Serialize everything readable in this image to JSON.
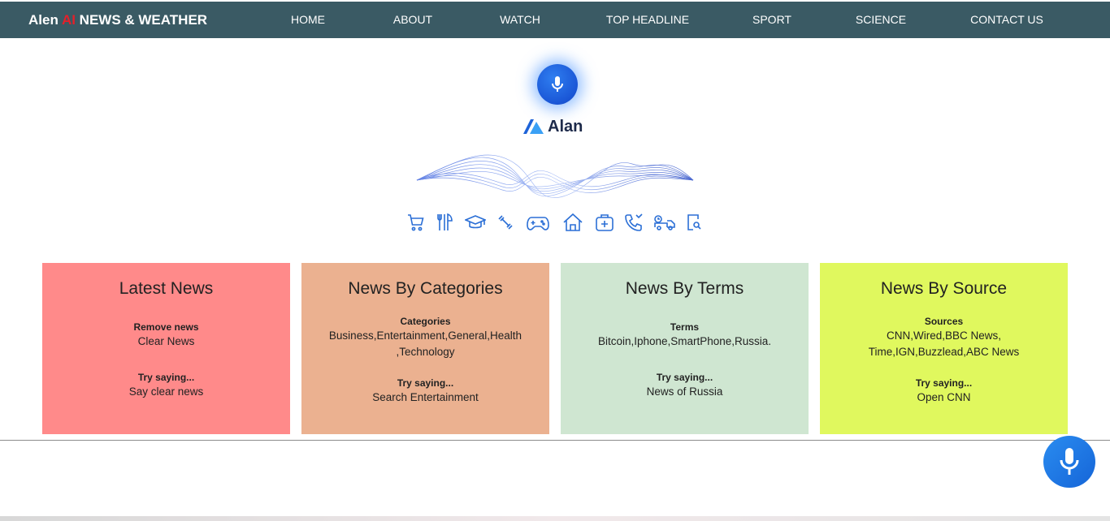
{
  "brand": {
    "prefix": "Alen ",
    "ai": "AI",
    "suffix": " NEWS & WEATHER"
  },
  "nav": [
    {
      "label": "HOME"
    },
    {
      "label": "ABOUT"
    },
    {
      "label": "WATCH"
    },
    {
      "label": "TOP HEADLINE"
    },
    {
      "label": "SPORT"
    },
    {
      "label": "SCIENCE"
    },
    {
      "label": "CONTACT US"
    }
  ],
  "assistant": {
    "name": "Alan"
  },
  "icons": [
    "cart-icon",
    "utensils-icon",
    "graduation-cap-icon",
    "fitness-icon",
    "gamepad-icon",
    "home-icon",
    "medical-kit-icon",
    "phone-icon",
    "delivery-truck-icon",
    "document-search-icon"
  ],
  "cards": [
    {
      "title": "Latest News",
      "label1": "Remove news",
      "value1": "Clear News",
      "label2": "Try saying...",
      "value2": "Say clear news",
      "color": "#ff8a8a"
    },
    {
      "title": "News By Categories",
      "label1": "Categories",
      "value1a": "Business,Entertainment,General,Health",
      "value1b": ",Technology",
      "label2": "Try saying...",
      "value2": "Search Entertainment",
      "color": "#ebb190"
    },
    {
      "title": "News By Terms",
      "label1": "Terms",
      "value1": "Bitcoin,Iphone,SmartPhone,Russia.",
      "label2": "Try saying...",
      "value2": "News of Russia",
      "color": "#cfe6d1"
    },
    {
      "title": "News By Source",
      "label1": "Sources",
      "value1a": "CNN,Wired,BBC News,",
      "value1b": "Time,IGN,Buzzlead,ABC News",
      "label2": "Try saying...",
      "value2": "Open CNN",
      "color": "#e0f85e"
    }
  ]
}
